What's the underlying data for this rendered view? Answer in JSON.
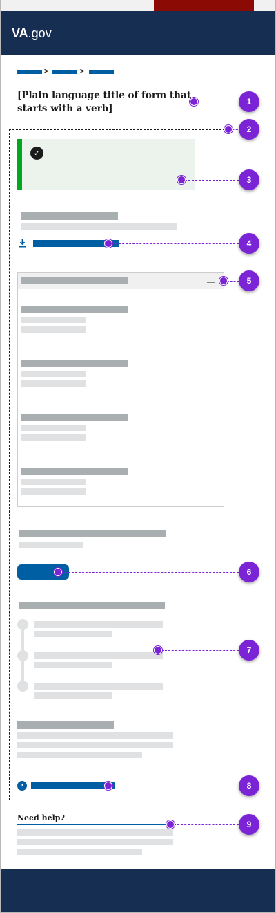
{
  "header": {
    "logo_bold": "VA",
    "logo_rest": ".gov"
  },
  "breadcrumb": {
    "separator": ">"
  },
  "page": {
    "title": "[Plain language title of form that starts with a verb]"
  },
  "alert": {
    "icon": "check-circle-icon",
    "status_color": "#00a91c"
  },
  "download": {
    "icon": "download-icon"
  },
  "accordion": {
    "collapse_symbol": "—"
  },
  "next_link": {
    "icon": "chevron-right-icon"
  },
  "help": {
    "heading": "Need help?"
  },
  "annotations": [
    "1",
    "2",
    "3",
    "4",
    "5",
    "6",
    "7",
    "8",
    "9"
  ],
  "colors": {
    "header": "#162e51",
    "primary": "#005ea2",
    "success": "#00a91c",
    "annotation": "#7b24d6",
    "banner": "#8b0a03"
  }
}
